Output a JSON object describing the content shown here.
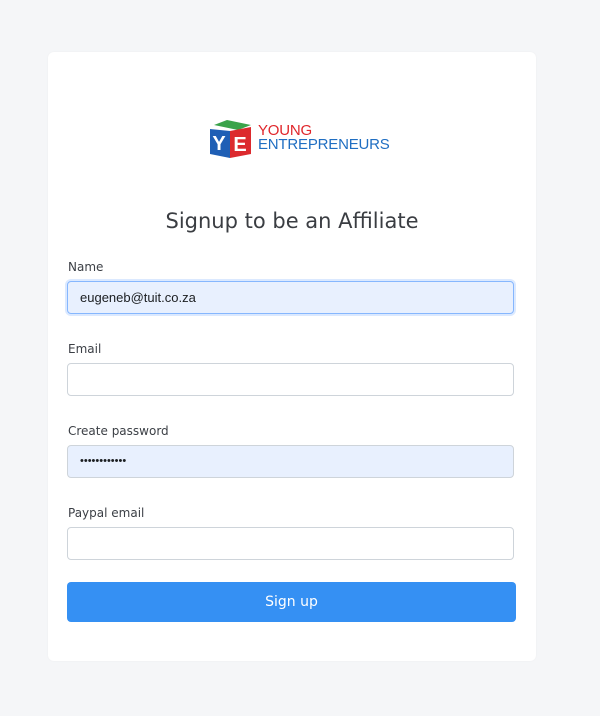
{
  "logo": {
    "line1": "YOUNG",
    "line2": "ENTREPRENEURS",
    "cube_letters": [
      "Y",
      "E"
    ]
  },
  "form": {
    "title": "Signup to be an Affiliate",
    "fields": [
      {
        "label": "Name",
        "value": "eugeneb@tuit.co.za",
        "placeholder": ""
      },
      {
        "label": "Email",
        "value": "",
        "placeholder": ""
      },
      {
        "label": "Create password",
        "value": "••••••••••••",
        "placeholder": ""
      },
      {
        "label": "Paypal email",
        "value": "",
        "placeholder": ""
      }
    ],
    "submit_label": "Sign up"
  },
  "colors": {
    "background": "#f5f6f8",
    "card": "#ffffff",
    "button": "#3590f3",
    "autofill": "#e8f0fe",
    "logo_red": "#e0262b",
    "logo_blue": "#1f6ec2"
  }
}
